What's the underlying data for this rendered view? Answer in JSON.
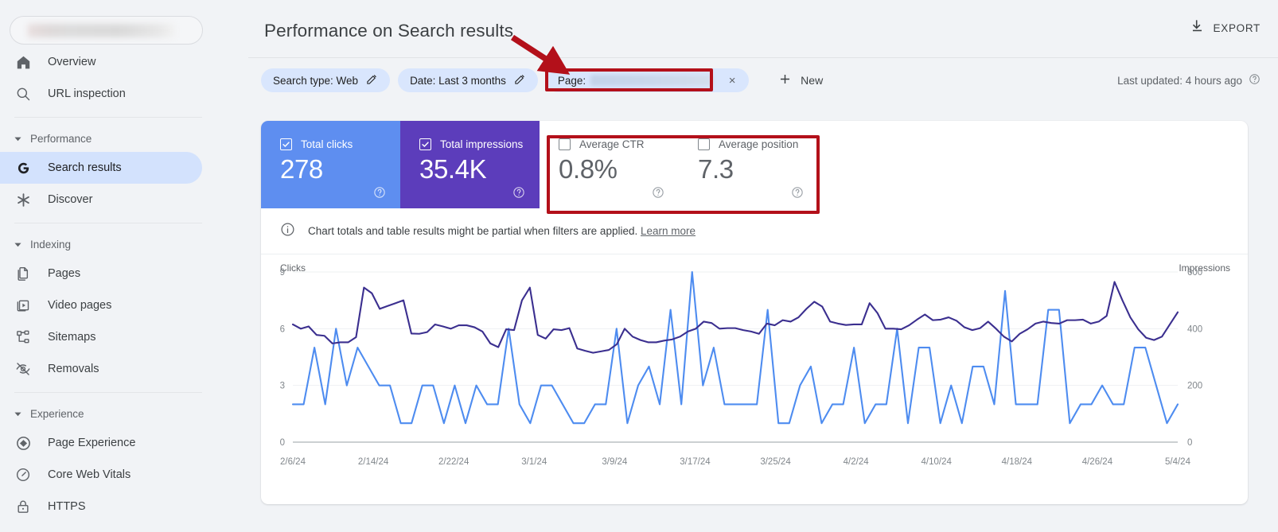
{
  "sidebar": {
    "property_selector": {
      "name": "property-selector",
      "value": "",
      "redacted": true
    },
    "items": [
      {
        "icon": "home-icon",
        "label": "Overview",
        "active": false
      },
      {
        "icon": "search-icon",
        "label": "URL inspection",
        "active": false
      }
    ],
    "sections": [
      {
        "label": "Performance",
        "items": [
          {
            "icon": "google-g-icon",
            "label": "Search results",
            "active": true
          },
          {
            "icon": "asterisk-icon",
            "label": "Discover",
            "active": false
          }
        ]
      },
      {
        "label": "Indexing",
        "items": [
          {
            "icon": "pages-icon",
            "label": "Pages",
            "active": false
          },
          {
            "icon": "video-icon",
            "label": "Video pages",
            "active": false
          },
          {
            "icon": "sitemap-icon",
            "label": "Sitemaps",
            "active": false
          },
          {
            "icon": "eye-off-icon",
            "label": "Removals",
            "active": false
          }
        ]
      },
      {
        "label": "Experience",
        "items": [
          {
            "icon": "page-experience-icon",
            "label": "Page Experience",
            "active": false
          },
          {
            "icon": "gauge-icon",
            "label": "Core Web Vitals",
            "active": false
          },
          {
            "icon": "lock-icon",
            "label": "HTTPS",
            "active": false
          }
        ]
      }
    ]
  },
  "header": {
    "title": "Performance on Search results",
    "export_label": "EXPORT",
    "last_updated": "Last updated: 4 hours ago"
  },
  "filters": {
    "chips": [
      {
        "label": "Search type: Web",
        "editable": true,
        "name": "filter-chip-search-type"
      },
      {
        "label": "Date: Last 3 months",
        "editable": true,
        "name": "filter-chip-date"
      }
    ],
    "page_chip": {
      "label": "Page:",
      "value": "",
      "redacted": true,
      "close": "×"
    },
    "new_label": "New"
  },
  "metrics": [
    {
      "name": "total-clicks",
      "label": "Total clicks",
      "value": "278",
      "checked": true,
      "theme": "clicks"
    },
    {
      "name": "total-impressions",
      "label": "Total impressions",
      "value": "35.4K",
      "checked": true,
      "theme": "impr"
    },
    {
      "name": "average-ctr",
      "label": "Average CTR",
      "value": "0.8%",
      "checked": false,
      "theme": "ctr"
    },
    {
      "name": "average-position",
      "label": "Average position",
      "value": "7.3",
      "checked": false,
      "theme": "pos"
    }
  ],
  "banner": {
    "text": "Chart totals and table results might be partial when filters are applied.",
    "link": "Learn more"
  },
  "annotations": {
    "highlight_color": "#b3101a",
    "arrow": {
      "from": "title-area",
      "to": "page-filter-chip"
    },
    "boxes": [
      "page-filter-chip",
      "ctr-and-position-cards"
    ]
  },
  "colors": {
    "clicks_blue": "#5e8ef0",
    "impressions_purple": "#5c3dbb",
    "clicks_line": "#4e8cf0",
    "impressions_line": "#3b2f8f",
    "active_nav_bg": "#d3e2fd",
    "chip_bg": "#d9e6fd",
    "annotation_red": "#b3101a"
  },
  "chart_data": {
    "type": "line",
    "title": "",
    "xlabel": "",
    "ylabel": "Clicks",
    "y2label": "Impressions",
    "grid": true,
    "legend": "none",
    "ylim": [
      0,
      9
    ],
    "yticks": [
      0,
      3,
      6,
      9
    ],
    "y2lim": [
      0,
      600
    ],
    "y2ticks": [
      0,
      200,
      400,
      600
    ],
    "xticks": [
      "2/6/24",
      "2/14/24",
      "2/22/24",
      "3/1/24",
      "3/9/24",
      "3/17/24",
      "3/25/24",
      "4/2/24",
      "4/10/24",
      "4/18/24",
      "4/26/24",
      "5/4/24"
    ],
    "series": [
      {
        "name": "Clicks",
        "axis": "left",
        "color": "#4e8cf0",
        "values": [
          2,
          2,
          5,
          2,
          6,
          3,
          5,
          4,
          3,
          3,
          1,
          1,
          3,
          3,
          1,
          3,
          1,
          3,
          2,
          2,
          6,
          2,
          1,
          3,
          3,
          2,
          1,
          1,
          2,
          2,
          6,
          1,
          3,
          4,
          2,
          7,
          2,
          9,
          3,
          5,
          2,
          2,
          2,
          2,
          7,
          1,
          1,
          3,
          4,
          1,
          2,
          2,
          5,
          1,
          2,
          2,
          6,
          1,
          5,
          5,
          1,
          3,
          1,
          4,
          4,
          2,
          8,
          2,
          2,
          2,
          7,
          7,
          1,
          2,
          2,
          3,
          2,
          2,
          5,
          5,
          3,
          1,
          2
        ]
      },
      {
        "name": "Impressions",
        "axis": "right",
        "color": "#3b2f8f",
        "values": [
          415,
          400,
          408,
          378,
          375,
          348,
          352,
          352,
          370,
          545,
          525,
          470,
          480,
          490,
          500,
          383,
          382,
          388,
          415,
          408,
          400,
          412,
          412,
          405,
          390,
          348,
          335,
          398,
          395,
          500,
          545,
          378,
          365,
          398,
          395,
          402,
          330,
          322,
          315,
          320,
          325,
          345,
          400,
          372,
          360,
          352,
          352,
          358,
          362,
          372,
          390,
          400,
          425,
          420,
          400,
          402,
          402,
          395,
          390,
          382,
          418,
          412,
          430,
          425,
          440,
          470,
          495,
          478,
          425,
          418,
          413,
          415,
          415,
          490,
          455,
          400,
          400,
          398,
          412,
          432,
          450,
          430,
          432,
          440,
          428,
          405,
          395,
          402,
          425,
          400,
          372,
          355,
          382,
          398,
          418,
          425,
          420,
          418,
          430,
          430,
          432,
          418,
          425,
          445,
          565,
          500,
          440,
          398,
          368,
          360,
          372,
          415,
          458
        ]
      }
    ]
  }
}
